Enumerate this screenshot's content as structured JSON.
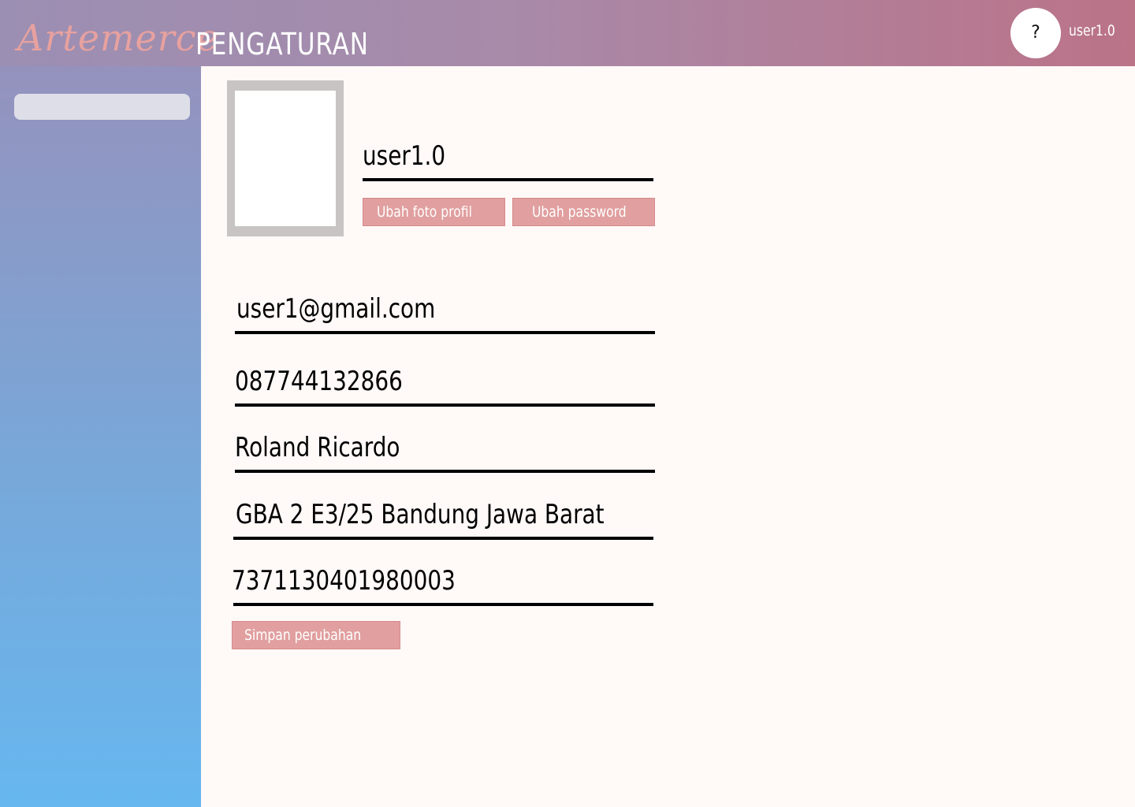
{
  "app": {
    "logo_text": "Artemerce",
    "page_title": "PENGATURAN"
  },
  "header": {
    "avatar_symbol": "?",
    "username": "user1.0"
  },
  "sidebar": {
    "search_placeholder": ""
  },
  "profile": {
    "username": "user1.0",
    "change_photo_label": "Ubah foto profil",
    "change_password_label": "Ubah password"
  },
  "form": {
    "email": "user1@gmail.com",
    "phone": "087744132866",
    "full_name": "Roland Ricardo",
    "address": "GBA 2 E3/25 Bandung Jawa Barat",
    "id_number": "7371130401980003",
    "save_label": "Simpan perubahan"
  },
  "colors": {
    "header_gradient_start": "#9b8fb3",
    "header_gradient_end": "#bb7388",
    "sidebar_gradient_start": "#9592bd",
    "sidebar_gradient_end": "#66b7ef",
    "button_bg": "#e19f9f",
    "logo": "#e7a19f"
  }
}
